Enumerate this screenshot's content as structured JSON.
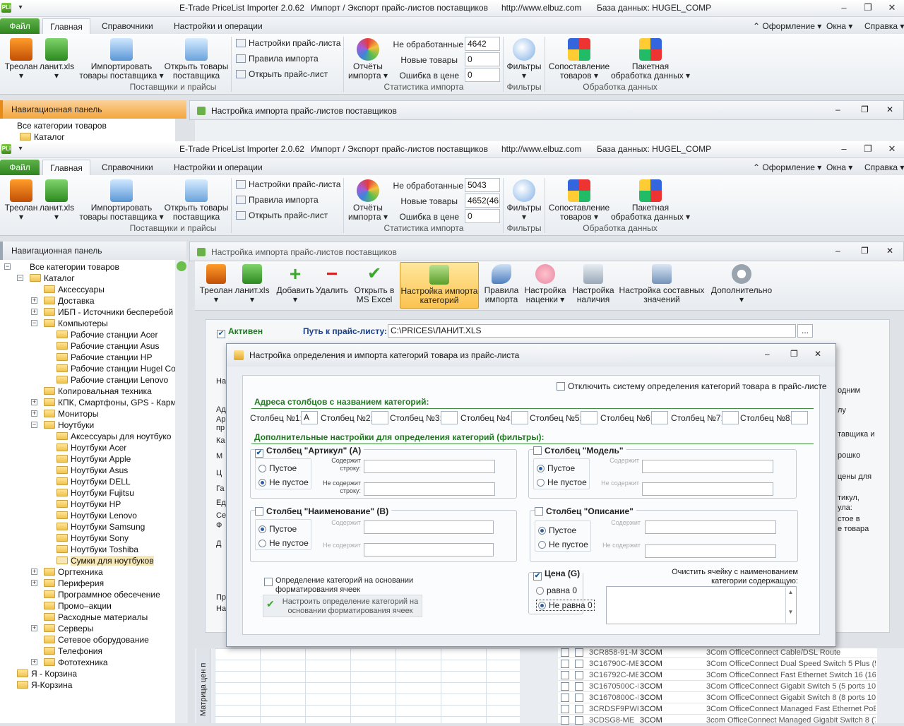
{
  "app": {
    "logo": "PLi",
    "title": "E-Trade PriceList Importer 2.0.62",
    "subtitle": "Импорт / Экспорт прайс-листов поставщиков",
    "url": "http://www.elbuz.com",
    "db": "База данных: HUGEL_COMP"
  },
  "tabs": {
    "file": "Файл",
    "home": "Главная",
    "refs": "Справочники",
    "settings": "Настройки и операции",
    "design": "Оформление",
    "windows": "Окна",
    "help": "Справка"
  },
  "ribbon": {
    "treolan": "Треолан",
    "lanit": "ланит.xls",
    "import_goods": [
      "Импортировать",
      "товары поставщика"
    ],
    "open_goods": [
      "Открыть товары",
      "поставщика"
    ],
    "group_suppliers": "Поставщики и прайсы",
    "pl_settings": "Настройки прайс-листа",
    "import_rules": "Правила импорта",
    "open_pl": "Открыть прайс-лист",
    "reports": [
      "Отчёты",
      "импорта"
    ],
    "stat_unprocessed": "Не обработанные",
    "stat_new": "Новые товары",
    "stat_error": "Ошибка в цене",
    "group_stats": "Статистика импорта",
    "filters": "Фильтры",
    "group_filters": "Фильтры",
    "matching": [
      "Сопоставление",
      "товаров"
    ],
    "batch": [
      "Пакетная",
      "обработка данных"
    ],
    "group_data": "Обработка данных"
  },
  "top": {
    "unprocessed": "4642",
    "new": "0",
    "error": "0"
  },
  "bottom": {
    "unprocessed": "5043",
    "new": "4652(465",
    "error": "0"
  },
  "nav": {
    "title": "Навигационная панель",
    "items": [
      "Все категории товаров",
      "Каталог",
      "Аксессуары",
      "Доставка",
      "ИБП - Источники бесперебой",
      "Компьютеры",
      "Рабочие станции Acer",
      "Рабочие станции Asus",
      "Рабочие станции HP",
      "Рабочие станции Hugel Co",
      "Рабочие станции Lenovo",
      "Копировальная техника",
      "КПК, Смартфоны, GPS - Карм",
      "Мониторы",
      "Ноутбуки",
      "Аксессуары для ноутбуко",
      "Ноутбуки Acer",
      "Ноутбуки Apple",
      "Ноутбуки Asus",
      "Ноутбуки DELL",
      "Ноутбуки Fujitsu",
      "Ноутбуки HP",
      "Ноутбуки Lenovo",
      "Ноутбуки Samsung",
      "Ноутбуки Sony",
      "Ноутбуки Toshiba",
      "Сумки для ноутбуков",
      "Оргтехника",
      "Периферия",
      "Программное обесечение",
      "Промо–акции",
      "Расходные материалы",
      "Серверы",
      "Сетевое оборудование",
      "Телефония",
      "Фототехника",
      "Я - Корзина",
      "Я-Корзина"
    ]
  },
  "import_window": {
    "title": "Настройка импорта прайс-листов поставщиков",
    "toolbar": {
      "treolan": "Треолан",
      "lanit": "ланит.xls",
      "add": "Добавить",
      "delete": "Удалить",
      "open_excel": [
        "Открыть в",
        "MS Excel"
      ],
      "cat_import": [
        "Настройка импорта",
        "категорий"
      ],
      "rules": [
        "Правила",
        "импорта"
      ],
      "markup": [
        "Настройка",
        "наценки"
      ],
      "stock": [
        "Настройка",
        "наличия"
      ],
      "composite": [
        "Настройка составных",
        "значений"
      ],
      "more": "Дополнительно"
    },
    "active_label": "Активен",
    "path_label": "Путь к прайс-листу:",
    "path_value": "C:\\PRICES\\ЛАНИТ.XLS",
    "browse": "...",
    "bg_right": [
      "одним",
      "лу",
      "тавщика и",
      "рошко",
      "цены для",
      "тикул,",
      "ула:",
      "стое в",
      "е товара"
    ],
    "bg_left": [
      "На",
      "Ад",
      "Ар",
      "пр",
      "Ка",
      "М",
      "Ц",
      "Га",
      "Ед",
      "Се",
      "Ф",
      "Д",
      "Пр",
      "На"
    ],
    "matrix_tab": "Матрица цен п",
    "rows": [
      [
        "3CR858-91-M",
        "3COM",
        "3Com OfficeConnect Cable/DSL Route"
      ],
      [
        "3C16790C-ME",
        "3COM",
        "3Com OfficeConnect Dual Speed Switch 5 Plus (5 p"
      ],
      [
        "3C16792C-ME",
        "3COM",
        "3Com OfficeConnect Fast Ethernet Switch 16 (16"
      ],
      [
        "3C1670500C-N",
        "3COM",
        "3Com OfficeConnect Gigabit Switch 5 (5 ports 10/"
      ],
      [
        "3C1670800C-N",
        "3COM",
        "3Com OfficeConnect Gigabit Switch 8 (8 ports 10/"
      ],
      [
        "3CRDSF9PWR",
        "3COM",
        "3Com OfficeConnect Managed Fast Ethernet PoE"
      ],
      [
        "3CDSG8-ME",
        "3COM",
        "3com OfficeConnect Managed Gigabit Switch 8 (7"
      ]
    ]
  },
  "dialog": {
    "title": "Настройка определения и импорта категорий товара из прайс-листа",
    "disable_system": "Отключить систему определения категорий товара в прайс-листе",
    "addresses_heading": "Адреса столбцов с названием категорий:",
    "columns": [
      {
        "label": "Столбец №1:",
        "value": "A"
      },
      {
        "label": "Столбец №2:",
        "value": ""
      },
      {
        "label": "Столбец №3:",
        "value": ""
      },
      {
        "label": "Столбец №4:",
        "value": ""
      },
      {
        "label": "Столбец №5:",
        "value": ""
      },
      {
        "label": "Столбец №6:",
        "value": ""
      },
      {
        "label": "Столбец №7:",
        "value": ""
      },
      {
        "label": "Столбец №8:",
        "value": ""
      }
    ],
    "extra_heading": "Дополнительные настройки для определения категорий (фильтры):",
    "empty": "Пустое",
    "not_empty": "Не пустое",
    "contains": [
      "Содержит",
      "строку:"
    ],
    "not_contains": [
      "Не содержит",
      "строку:"
    ],
    "faded_contains": "Содержит",
    "faded_not_contains": "Не содержит",
    "col_article": "Столбец \"Артикул\" (A)",
    "col_model": "Столбец \"Модель\"",
    "col_name": "Столбец \"Наименование\" (B)",
    "col_desc": "Столбец \"Описание\"",
    "price": "Цена (G)",
    "price_zero": "равна 0",
    "price_nonzero": "Не равна 0",
    "clear_label": [
      "Очистить ячейку с наименованием",
      "категории содержащую:"
    ],
    "format_check": [
      "Определение категорий на основании",
      "форматирования ячеек"
    ],
    "format_btn": [
      "Настроить определение категорий на",
      "основании форматирования ячеек"
    ]
  }
}
